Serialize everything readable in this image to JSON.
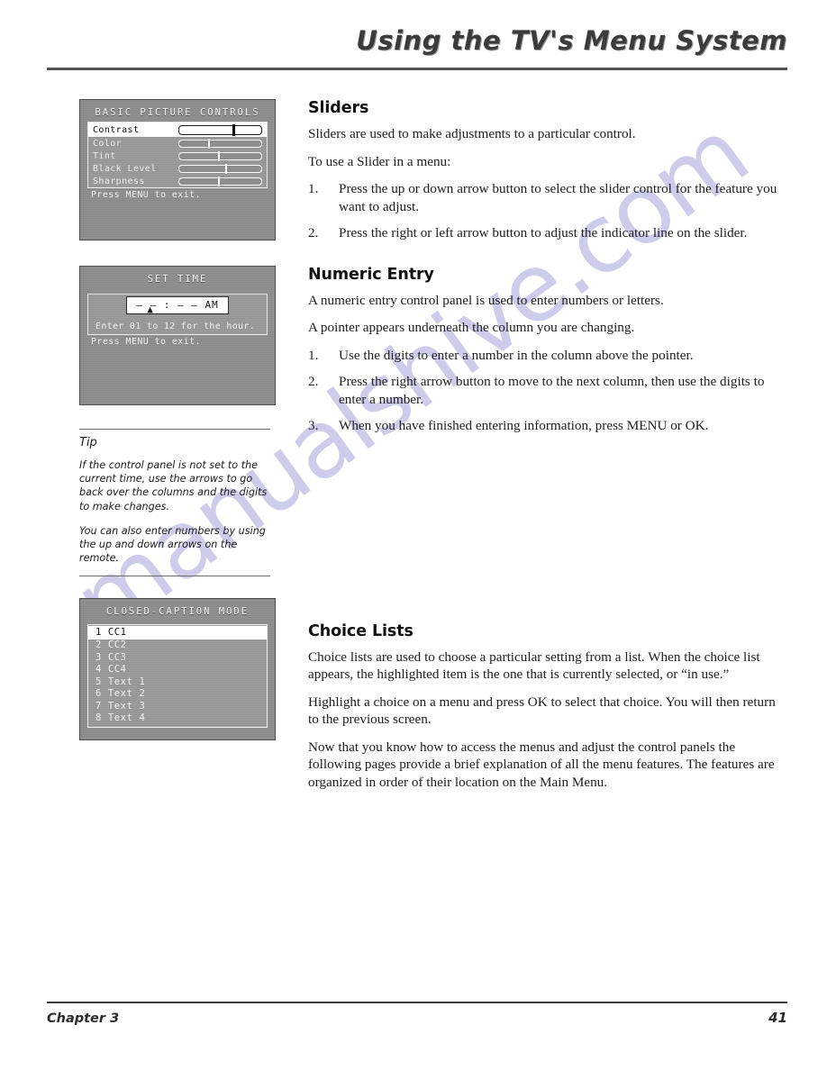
{
  "header": {
    "title": "Using the TV's Menu System"
  },
  "watermark": {
    "text": "manualshive.com",
    "color": "#c9c9ea"
  },
  "menus": {
    "basic_picture": {
      "title": "BASIC PICTURE CONTROLS",
      "rows": [
        {
          "label": "Contrast",
          "value": 66,
          "selected": true
        },
        {
          "label": "Color",
          "value": 36,
          "selected": false
        },
        {
          "label": "Tint",
          "value": 48,
          "selected": false
        },
        {
          "label": "Black Level",
          "value": 57,
          "selected": false
        },
        {
          "label": "Sharpness",
          "value": 48,
          "selected": false
        }
      ],
      "footer": "Press MENU to exit."
    },
    "set_time": {
      "title": "SET TIME",
      "entry": "—  —  :  —  —    AM",
      "pointer": "▲",
      "line1": "Enter 01 to 12 for the hour.",
      "line2": "Press MENU to exit."
    },
    "closed_caption": {
      "title": "CLOSED-CAPTION MODE",
      "items": [
        {
          "label": "1 CC1",
          "selected": true
        },
        {
          "label": "2 CC2",
          "selected": false
        },
        {
          "label": "3 CC3",
          "selected": false
        },
        {
          "label": "4 CC4",
          "selected": false
        },
        {
          "label": "5 Text 1",
          "selected": false
        },
        {
          "label": "6 Text 2",
          "selected": false
        },
        {
          "label": "7 Text 3",
          "selected": false
        },
        {
          "label": "8 Text 4",
          "selected": false
        }
      ]
    }
  },
  "tip": {
    "heading": "Tip",
    "paragraph1": "If the control panel is not set to the current time, use the arrows to go back over the columns and the digits to make changes.",
    "paragraph2": "You can also enter numbers by using the up and down arrows on the remote."
  },
  "sections": {
    "sliders": {
      "heading": "Sliders",
      "p1": "Sliders are used to make adjustments to a particular control.",
      "p2": "To use a Slider in a menu:",
      "steps": [
        {
          "num": "1.",
          "text": "Press the up or down arrow button to select the slider control for the feature you want to adjust."
        },
        {
          "num": "2.",
          "text": "Press the right or left arrow button to adjust the indicator line on the slider."
        }
      ]
    },
    "numeric_entry": {
      "heading": "Numeric Entry",
      "p1": "A numeric entry control panel is used to enter numbers or letters.",
      "p2": "A pointer appears underneath the column you are changing.",
      "steps": [
        {
          "num": "1.",
          "text": "Use the digits to enter a number in the column above the pointer."
        },
        {
          "num": "2.",
          "text": "Press the right arrow button to move to the next column, then use the digits to enter a number."
        },
        {
          "num": "3.",
          "text": "When you have finished entering information, press MENU or OK."
        }
      ]
    },
    "choice_lists": {
      "heading": "Choice Lists",
      "p1": "Choice lists are used to choose a particular setting from a list. When the choice list appears, the highlighted item is the one that is currently selected, or “in use.”",
      "p2": "Highlight a choice on a menu and press OK to select that choice. You will then return to the previous screen.",
      "p3": "Now that you know how to access the menus and adjust the control panels the following pages provide a brief explanation of all the menu features. The features are organized in order of their location on the Main Menu."
    }
  },
  "footer": {
    "chapter": "Chapter 3",
    "page": "41"
  }
}
